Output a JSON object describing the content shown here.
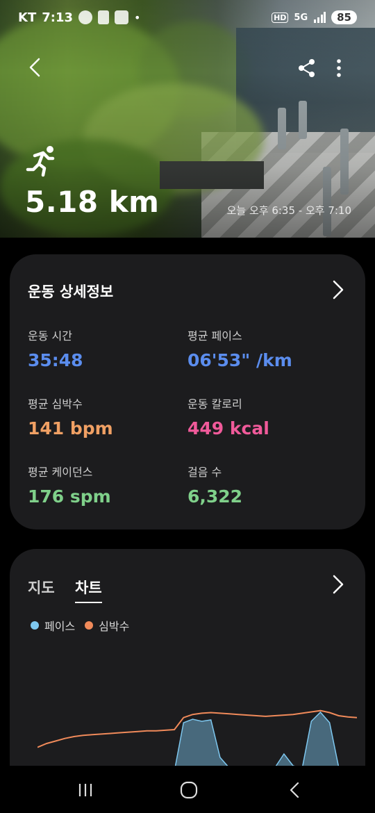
{
  "status_bar": {
    "carrier": "KT",
    "time": "7:13",
    "hd": "HD",
    "network": "5G",
    "battery": "85"
  },
  "hero": {
    "distance": "5.18 km",
    "time_range": "오늘 오후 6:35 - 오후 7:10",
    "activity_icon": "running-person-icon"
  },
  "details": {
    "title": "운동 상세정보",
    "stats": [
      {
        "label": "운동 시간",
        "value": "35:48",
        "color": "#5b8dee"
      },
      {
        "label": "평균 페이스",
        "value": "06'53\" /km",
        "color": "#5b8dee"
      },
      {
        "label": "평균 심박수",
        "value": "141 bpm",
        "color": "#f0a064"
      },
      {
        "label": "운동 칼로리",
        "value": "449 kcal",
        "color": "#f05a9a"
      },
      {
        "label": "평균 케이던스",
        "value": "176 spm",
        "color": "#7fd08a"
      },
      {
        "label": "걸음 수",
        "value": "6,322",
        "color": "#7fd08a"
      }
    ]
  },
  "chart_section": {
    "tabs": [
      "지도",
      "차트"
    ],
    "active_tab": "차트",
    "legend": [
      {
        "name": "페이스",
        "color": "#7ec8f0"
      },
      {
        "name": "심박수",
        "color": "#f08a5a"
      }
    ]
  },
  "chart_data": {
    "type": "area",
    "x": [
      0,
      1,
      2,
      3,
      4,
      5,
      6,
      7,
      8,
      9,
      10,
      11,
      12,
      13,
      14,
      15,
      16,
      17,
      18,
      19,
      20,
      21,
      22,
      23,
      24,
      25,
      26,
      27,
      28,
      29,
      30,
      31,
      32,
      33,
      34,
      35
    ],
    "series": [
      {
        "name": "심박수",
        "values": [
          98,
          104,
          108,
          112,
          115,
          117,
          118,
          119,
          120,
          121,
          122,
          123,
          124,
          124,
          125,
          126,
          145,
          150,
          152,
          153,
          152,
          151,
          150,
          149,
          148,
          147,
          148,
          149,
          150,
          152,
          154,
          156,
          153,
          148,
          146,
          145
        ]
      },
      {
        "name": "페이스",
        "values": [
          0,
          0,
          0,
          0,
          0,
          0,
          0,
          0,
          0,
          0,
          0,
          0,
          0,
          0,
          0,
          0,
          70,
          75,
          72,
          74,
          20,
          5,
          3,
          4,
          3,
          2,
          5,
          25,
          8,
          4,
          72,
          85,
          70,
          6,
          3,
          2
        ]
      }
    ]
  },
  "nav_bar": {
    "recents_icon": "recents-icon",
    "home_icon": "home-icon",
    "back_icon": "back-icon"
  }
}
